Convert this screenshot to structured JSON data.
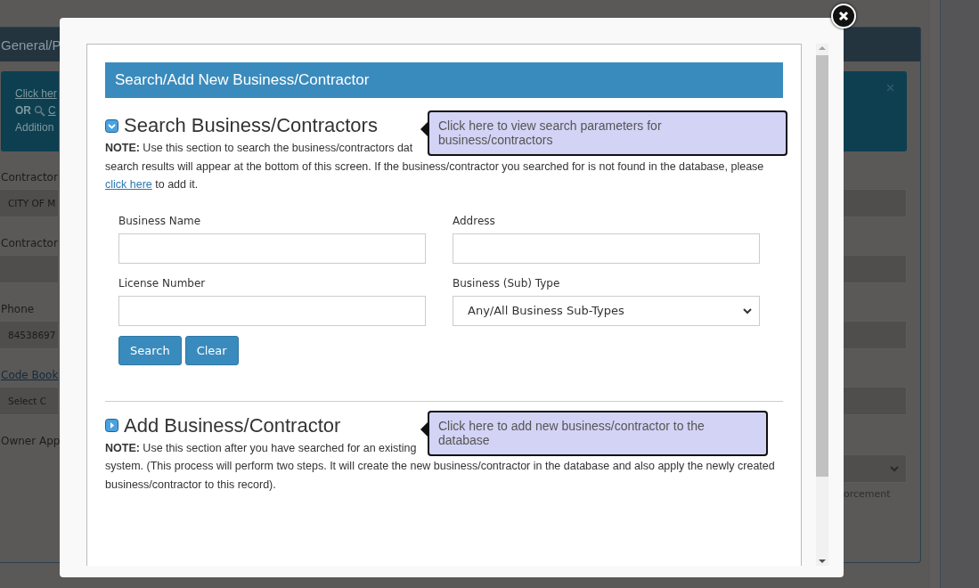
{
  "background": {
    "panel_title": "General/P",
    "info": {
      "link_1": "Click her",
      "or": "OR",
      "link_2": "C",
      "line_3": "Addition"
    },
    "fields": [
      {
        "kind": "text",
        "label": "Contractor",
        "value": "CITY OF M"
      },
      {
        "kind": "text",
        "label": "Contractor"
      },
      {
        "kind": "text",
        "label": "Phone",
        "value": "84538697"
      },
      {
        "kind": "select",
        "label": "Code Book",
        "label_link": true,
        "value": "Select C"
      },
      {
        "kind": "none",
        "label": "Owner App"
      }
    ],
    "right_note": "orcement"
  },
  "modal": {
    "header": "Search/Add New Business/Contractor",
    "sections": [
      {
        "title": "Search Business/Contractors",
        "expanded": true,
        "tooltip": "Click here to view search parameters for business/contractors",
        "note_lines": [
          [
            {
              "bold": "NOTE:"
            },
            {
              "text": " Use this section to search the business/contractors dat"
            }
          ],
          [
            {
              "text": "search results will appear at the bottom of this screen. If the business/contractor you searched for is not found in the database, please "
            },
            {
              "link": "click here"
            },
            {
              "text": " to add it."
            }
          ]
        ],
        "form": {
          "fields": [
            {
              "kind": "input",
              "label": "Business Name"
            },
            {
              "kind": "input",
              "label": "Address"
            },
            {
              "kind": "input",
              "label": "License Number"
            },
            {
              "kind": "select",
              "label": "Business (Sub) Type",
              "value": "Any/All Business Sub-Types"
            }
          ],
          "buttons": [
            "Search",
            "Clear"
          ]
        }
      },
      {
        "title": "Add Business/Contractor",
        "expanded": false,
        "tooltip": "Click here to add new business/contractor to the database",
        "note_lines": [
          [
            {
              "bold": "NOTE:"
            },
            {
              "text": " Use this section after you have searched for an existing"
            }
          ],
          [
            {
              "text": "system. (This process will perform two steps. It will create the new business/contractor in the database and also apply the newly created business/contractor to this record)."
            }
          ]
        ]
      }
    ]
  }
}
